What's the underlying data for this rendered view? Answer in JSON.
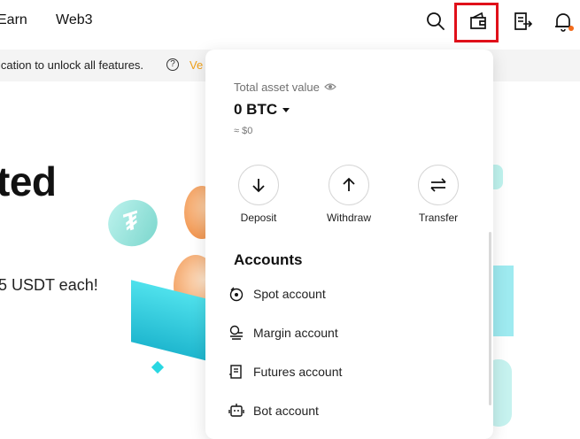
{
  "nav": {
    "items": [
      "Earn",
      "Web3"
    ],
    "icons": [
      "search-icon",
      "wallet-icon",
      "orders-icon",
      "bell-icon"
    ]
  },
  "banner": {
    "text": "ication to unlock all features.",
    "link": "Ve"
  },
  "hero": {
    "title": "ted",
    "subtitle": "5 USDT each!"
  },
  "wallet_panel": {
    "total_label": "Total asset value",
    "total_value": "0 BTC",
    "approx": "≈ $0",
    "actions": [
      {
        "label": "Deposit",
        "icon": "arrow-down-icon"
      },
      {
        "label": "Withdraw",
        "icon": "arrow-up-icon"
      },
      {
        "label": "Transfer",
        "icon": "transfer-icon"
      }
    ],
    "accounts_title": "Accounts",
    "accounts": [
      {
        "label": "Spot account",
        "icon": "spot-icon"
      },
      {
        "label": "Margin account",
        "icon": "margin-icon"
      },
      {
        "label": "Futures account",
        "icon": "futures-icon"
      },
      {
        "label": "Bot account",
        "icon": "bot-icon"
      }
    ]
  },
  "colors": {
    "highlight": "#e0101a",
    "link": "#f0a11a",
    "accent_teal": "#29d7e2",
    "notification_dot": "#f36b1b"
  }
}
